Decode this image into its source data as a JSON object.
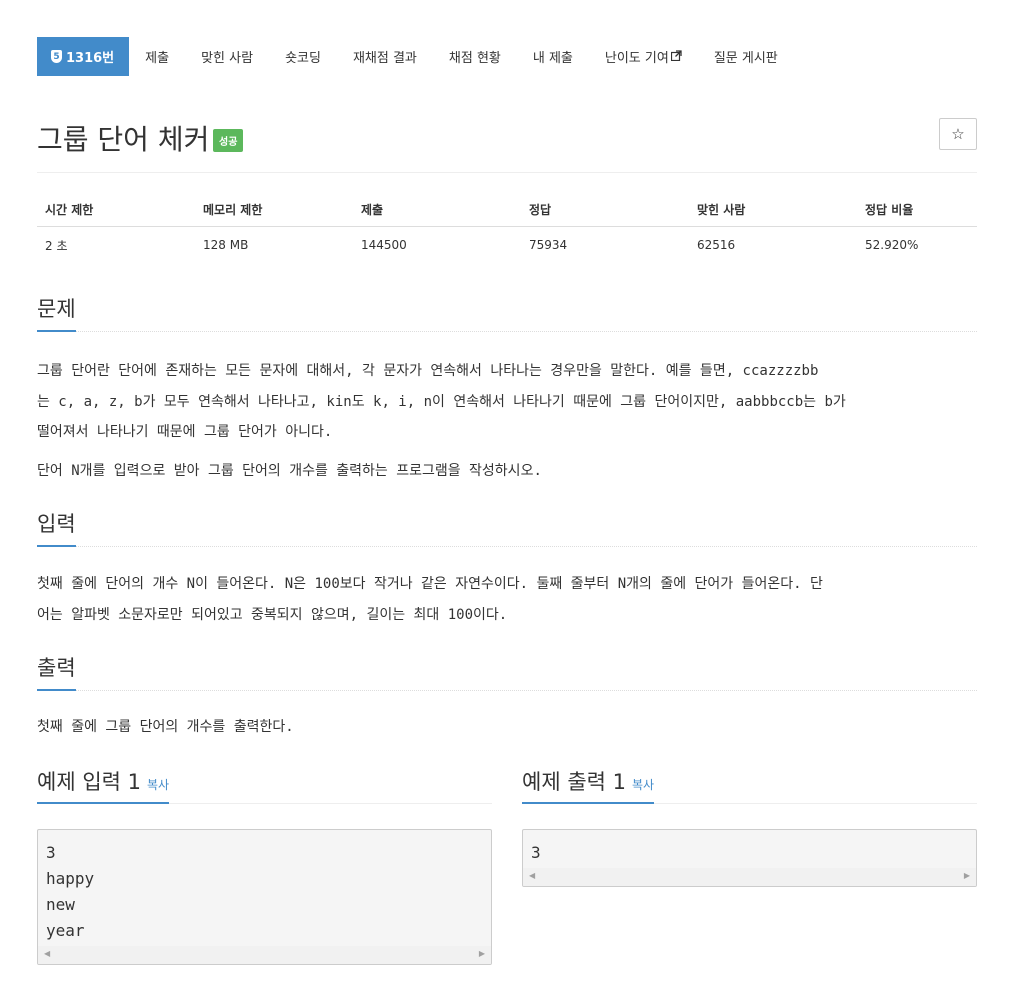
{
  "nav": {
    "problem_number_badge": "5",
    "problem_number": "1316번",
    "items": [
      "제출",
      "맞힌 사람",
      "숏코딩",
      "재채점 결과",
      "채점 현황",
      "내 제출",
      "난이도 기여",
      "질문 게시판"
    ]
  },
  "problem": {
    "title": "그룹 단어 체커",
    "status": "성공",
    "star": "☆"
  },
  "info_table": {
    "headers": [
      "시간 제한",
      "메모리 제한",
      "제출",
      "정답",
      "맞힌 사람",
      "정답 비율"
    ],
    "values": [
      "2 초",
      "128 MB",
      "144500",
      "75934",
      "62516",
      "52.920%"
    ]
  },
  "sections": {
    "problem_heading": "문제",
    "problem_lines": [
      "그룹 단어란 단어에 존재하는 모든 문자에 대해서, 각 문자가 연속해서 나타나는 경우만을 말한다. 예를 들면, ccazzzzbb",
      "는 c, a, z, b가 모두 연속해서 나타나고, kin도 k, i, n이 연속해서 나타나기 때문에 그룹 단어이지만, aabbbccb는 b가",
      "떨어져서 나타나기 때문에 그룹 단어가 아니다."
    ],
    "problem_line2": "단어 N개를 입력으로 받아 그룹 단어의 개수를 출력하는 프로그램을 작성하시오.",
    "input_heading": "입력",
    "input_lines": [
      "첫째 줄에 단어의 개수 N이 들어온다. N은 100보다 작거나 같은 자연수이다. 둘째 줄부터 N개의 줄에 단어가 들어온다. 단",
      "어는 알파벳 소문자로만 되어있고 중복되지 않으며, 길이는 최대 100이다."
    ],
    "output_heading": "출력",
    "output_text": "첫째 줄에 그룹 단어의 개수를 출력한다."
  },
  "samples": {
    "input_title": "예제 입력 1",
    "output_title": "예제 출력 1",
    "copy_label": "복사",
    "input_lines": [
      "3",
      "happy",
      "new",
      "year"
    ],
    "output_lines": [
      "3"
    ]
  },
  "colors": {
    "accent": "#428bca",
    "success": "#5cb85c"
  }
}
